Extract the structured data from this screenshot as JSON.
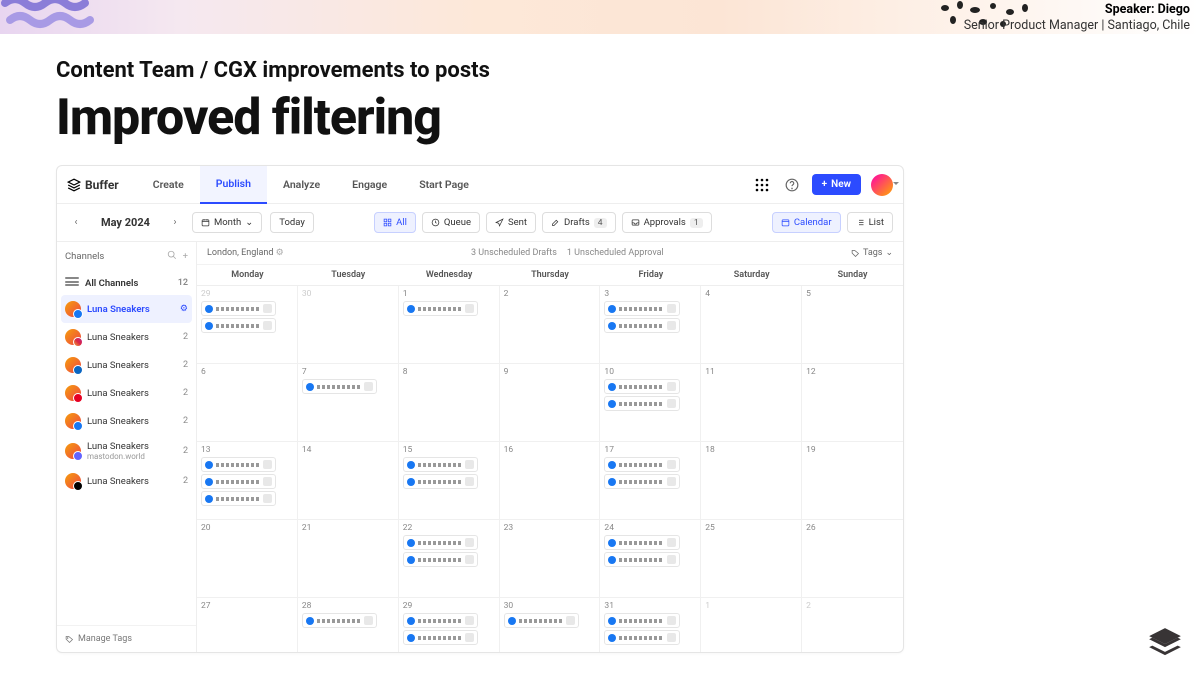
{
  "speaker": {
    "prefix": "Speaker:",
    "name": "Diego",
    "title": "Senior Product Manager | Santiago, Chile"
  },
  "slide": {
    "breadcrumb": "Content Team /  CGX improvements to posts",
    "title": "Improved filtering"
  },
  "brand": "Buffer",
  "nav": {
    "tabs": [
      "Create",
      "Publish",
      "Analyze",
      "Engage",
      "Start Page"
    ],
    "activeIndex": 1,
    "newLabel": "New"
  },
  "toolbar": {
    "monthLabel": "May 2024",
    "monthBtn": "Month",
    "todayBtn": "Today",
    "filters": {
      "all": "All",
      "queue": "Queue",
      "sent": "Sent",
      "drafts": "Drafts",
      "draftsCount": "4",
      "approvals": "Approvals",
      "approvalsCount": "1"
    },
    "views": {
      "calendar": "Calendar",
      "list": "List"
    }
  },
  "sidebar": {
    "title": "Channels",
    "all": {
      "label": "All Channels",
      "count": "12"
    },
    "items": [
      {
        "name": "Luna Sneakers",
        "count": "",
        "net": "fb",
        "active": true
      },
      {
        "name": "Luna Sneakers",
        "count": "2",
        "net": "ig"
      },
      {
        "name": "Luna Sneakers",
        "count": "2",
        "net": "li"
      },
      {
        "name": "Luna Sneakers",
        "count": "2",
        "net": "pi"
      },
      {
        "name": "Luna Sneakers",
        "count": "2",
        "net": "fb"
      },
      {
        "name": "Luna Sneakers",
        "count": "2",
        "net": "ma",
        "sub": "mastodon.world"
      },
      {
        "name": "Luna Sneakers",
        "count": "2",
        "net": "tw"
      }
    ],
    "manageTags": "Manage Tags"
  },
  "mainHeader": {
    "location": "London, England",
    "status1": "3 Unscheduled Drafts",
    "status2": "1 Unscheduled Approval",
    "tags": "Tags"
  },
  "weekdays": [
    "Monday",
    "Tuesday",
    "Wednesday",
    "Thursday",
    "Friday",
    "Saturday",
    "Sunday"
  ],
  "days": [
    {
      "n": "29",
      "other": true,
      "posts": 2
    },
    {
      "n": "30",
      "other": true,
      "posts": 0
    },
    {
      "n": "1",
      "posts": 1
    },
    {
      "n": "2",
      "posts": 0
    },
    {
      "n": "3",
      "posts": 2
    },
    {
      "n": "4",
      "posts": 0
    },
    {
      "n": "5",
      "posts": 0
    },
    {
      "n": "6",
      "posts": 0
    },
    {
      "n": "7",
      "posts": 1
    },
    {
      "n": "8",
      "posts": 0
    },
    {
      "n": "9",
      "posts": 0
    },
    {
      "n": "10",
      "posts": 2
    },
    {
      "n": "11",
      "posts": 0
    },
    {
      "n": "12",
      "posts": 0
    },
    {
      "n": "13",
      "posts": 3
    },
    {
      "n": "14",
      "posts": 0
    },
    {
      "n": "15",
      "posts": 2
    },
    {
      "n": "16",
      "posts": 0
    },
    {
      "n": "17",
      "posts": 2
    },
    {
      "n": "18",
      "posts": 0
    },
    {
      "n": "19",
      "posts": 0
    },
    {
      "n": "20",
      "posts": 0
    },
    {
      "n": "21",
      "posts": 0
    },
    {
      "n": "22",
      "posts": 2
    },
    {
      "n": "23",
      "posts": 0
    },
    {
      "n": "24",
      "posts": 2
    },
    {
      "n": "25",
      "posts": 0
    },
    {
      "n": "26",
      "posts": 0
    },
    {
      "n": "27",
      "posts": 0
    },
    {
      "n": "28",
      "posts": 1
    },
    {
      "n": "29",
      "posts": 2
    },
    {
      "n": "30",
      "posts": 1
    },
    {
      "n": "31",
      "posts": 2
    },
    {
      "n": "1",
      "other": true,
      "posts": 0
    },
    {
      "n": "2",
      "other": true,
      "posts": 0
    }
  ]
}
